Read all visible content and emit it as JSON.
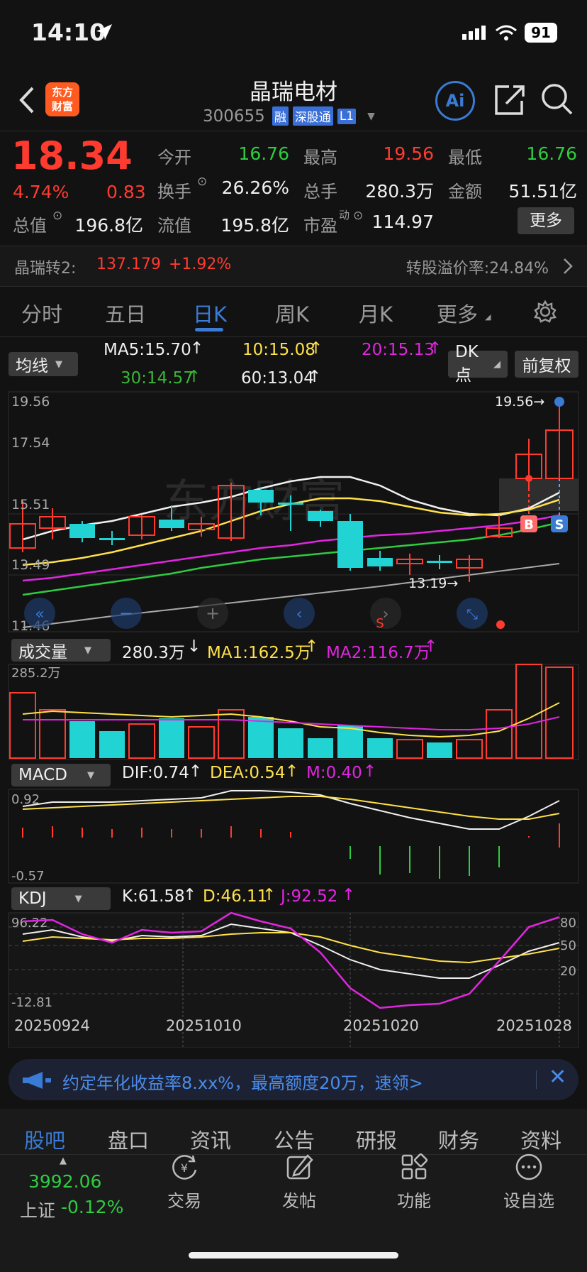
{
  "status": {
    "time": "14:10",
    "battery": "91"
  },
  "header": {
    "title": "晶瑞电材",
    "code": "300655",
    "tags": [
      "融",
      "深股通",
      "L1"
    ],
    "logo_line1": "东方",
    "logo_line2": "财富",
    "ai": "Ai"
  },
  "quote": {
    "price": "18.34",
    "pct": "4.74%",
    "chg": "0.83",
    "open_label": "今开",
    "open": "16.76",
    "high_label": "最高",
    "high": "19.56",
    "low_label": "最低",
    "low": "16.76",
    "turnover_label": "换手",
    "turnover": "26.26%",
    "vol_label": "总手",
    "vol": "280.3万",
    "amount_label": "金额",
    "amount": "51.51亿",
    "mcap_label": "总值",
    "mcap": "196.8亿",
    "float_label": "流值",
    "float": "195.8亿",
    "pe_label": "市盈",
    "pe_sup": "动",
    "pe": "114.97",
    "more": "更多"
  },
  "bond": {
    "name": "晶瑞转2:",
    "price": "137.179",
    "chg": "+1.92%",
    "premium": "转股溢价率:24.84%"
  },
  "tabs": [
    "分时",
    "五日",
    "日K",
    "周K",
    "月K",
    "更多"
  ],
  "ma": {
    "selector": "均线",
    "ma5": "MA5:15.70",
    "ma10": "10:15.08",
    "ma20": "20:15.13",
    "ma30": "30:14.57",
    "ma60": "60:13.04",
    "dk": "DK点",
    "adjust": "前复权"
  },
  "kline": {
    "y_labels": [
      "19.56",
      "17.54",
      "15.51",
      "13.49",
      "11.46"
    ],
    "high_mark": "19.56→",
    "low_mark": "13.19→",
    "b": "B",
    "s": "S",
    "s2": "S"
  },
  "volume": {
    "selector": "成交量",
    "val": "280.3万",
    "ma1": "MA1:162.5万",
    "ma2": "MA2:116.7万",
    "max": "285.2万"
  },
  "macd": {
    "selector": "MACD",
    "dif": "DIF:0.74",
    "dea": "DEA:0.54",
    "m": "M:0.40",
    "top": "0.92",
    "bottom": "-0.57"
  },
  "kdj": {
    "selector": "KDJ",
    "k": "K:61.58",
    "d": "D:46.11",
    "j": "J:92.52",
    "top": "96.22",
    "bottom": "-12.81",
    "r80": "80",
    "r50": "50",
    "r20": "20",
    "dates": [
      "20250924",
      "20251010",
      "20251020",
      "20251028"
    ]
  },
  "ad": {
    "text": "约定年化收益率8.xx%，最高额度20万，速领>"
  },
  "bottom_tabs": [
    "股吧",
    "盘口",
    "资讯",
    "公告",
    "研报",
    "财务",
    "资料"
  ],
  "index": {
    "value": "3992.06",
    "name": "上证",
    "chg": "-0.12%"
  },
  "nav": [
    "交易",
    "发帖",
    "功能",
    "设自选"
  ],
  "colors": {
    "up": "#ff3b30",
    "down": "#22d3d3",
    "accent": "#3a7bd5"
  }
}
